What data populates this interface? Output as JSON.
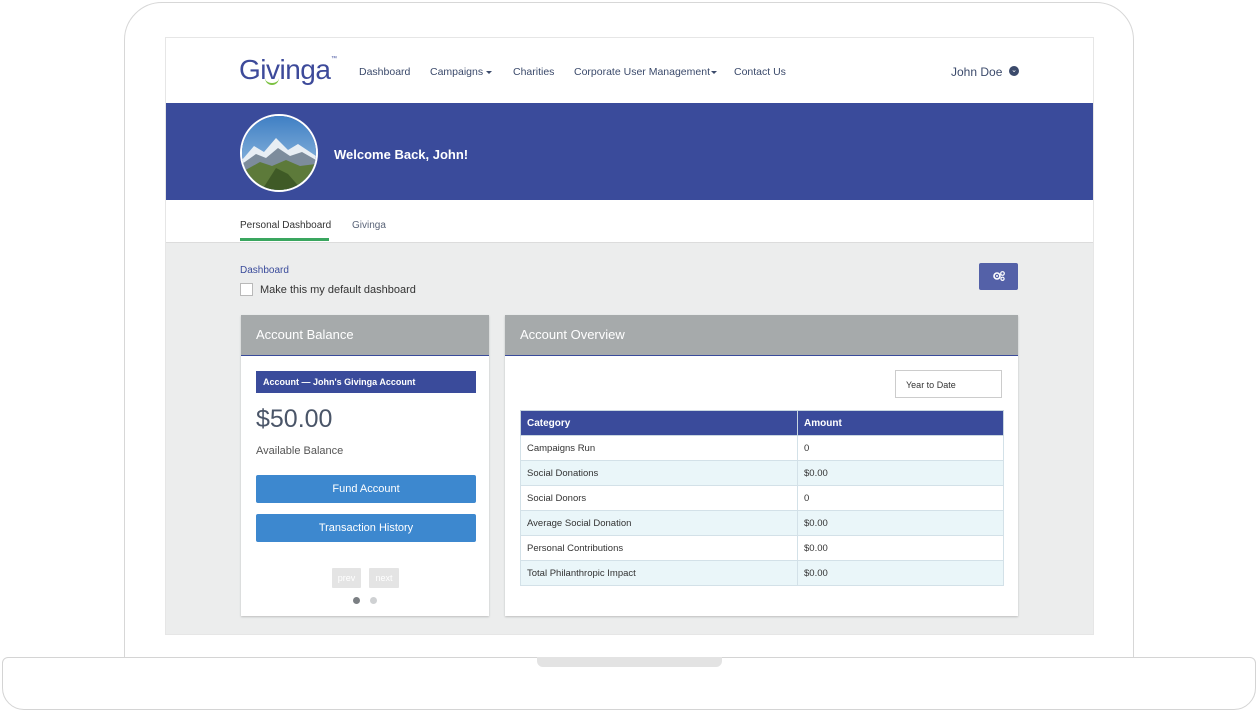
{
  "app": {
    "logo_text": "Givinga",
    "logo_tm": "™"
  },
  "nav": {
    "items": [
      {
        "label": "Dashboard",
        "has_caret": false
      },
      {
        "label": "Campaigns",
        "has_caret": true
      },
      {
        "label": "Charities",
        "has_caret": false
      },
      {
        "label": "Corporate User Management",
        "has_caret": true
      },
      {
        "label": "Contact Us",
        "has_caret": false
      }
    ],
    "user_name": "John Doe",
    "user_menu_icon": "chevron-down-circle-icon"
  },
  "banner": {
    "welcome": "Welcome Back, John!",
    "avatar_alt": "mountain-landscape-avatar"
  },
  "tabs": [
    {
      "label": "Personal Dashboard",
      "active": true
    },
    {
      "label": "Givinga",
      "active": false
    }
  ],
  "breadcrumb": "Dashboard",
  "default_dashboard": {
    "label": "Make this my default dashboard",
    "checked": false
  },
  "settings_button_icon": "gears-icon",
  "account_balance": {
    "title": "Account Balance",
    "account_label": "Account — John's Givinga Account",
    "balance": "$50.00",
    "balance_caption": "Available Balance",
    "fund_button": "Fund Account",
    "history_button": "Transaction History",
    "prev_label": "prev",
    "next_label": "next",
    "carousel_active_index": 0,
    "carousel_count": 2
  },
  "account_overview": {
    "title": "Account Overview",
    "period": "Year to Date",
    "columns": [
      "Category",
      "Amount"
    ],
    "rows": [
      [
        "Campaigns Run",
        "0"
      ],
      [
        "Social Donations",
        "$0.00"
      ],
      [
        "Social Donors",
        "0"
      ],
      [
        "Average Social Donation",
        "$0.00"
      ],
      [
        "Personal Contributions",
        "$0.00"
      ],
      [
        "Total Philanthropic Impact",
        "$0.00"
      ]
    ]
  },
  "colors": {
    "brand_navy": "#3a4b9b",
    "accent_green": "#3aa65f",
    "button_blue": "#3d88cf"
  }
}
